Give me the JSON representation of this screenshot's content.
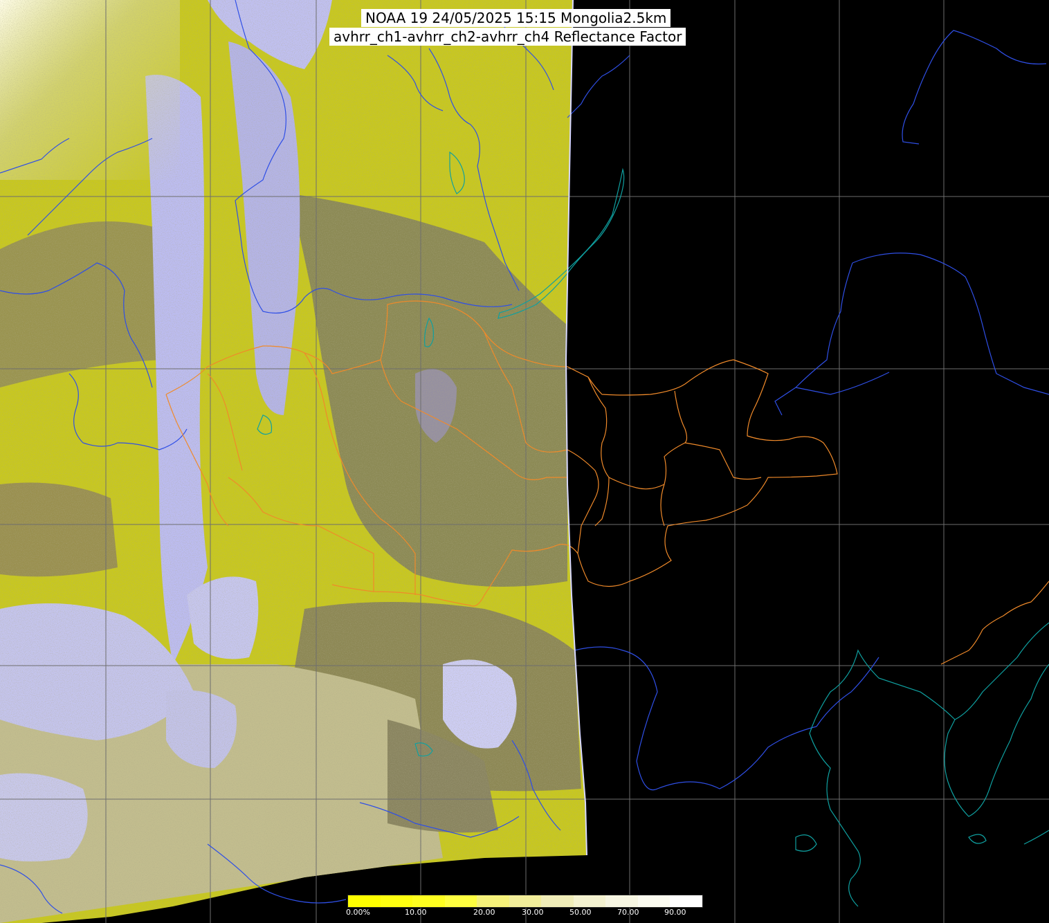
{
  "title": {
    "line1": "NOAA 19 24/05/2025 15:15 Mongolia2.5km",
    "line2": "avhrr_ch1-avhrr_ch2-avhrr_ch4 Reflectance Factor"
  },
  "legend": {
    "labels": [
      "0.00%",
      "10.00",
      "20.00",
      "30.00",
      "50.00",
      "70.00",
      "90.00"
    ],
    "colors": [
      "#ffff00",
      "#ffff10",
      "#ffff20",
      "#ffff40",
      "#f6f27a",
      "#f2ee9a",
      "#f0edb8",
      "#f4f2d0",
      "#f7f6e2",
      "#fbfbf0",
      "#ffffff"
    ]
  },
  "colors": {
    "background": "#000000",
    "scene_yellow": "#c8c81e",
    "scene_olive": "#8c8a55",
    "scene_cloud": "#bcbcf0",
    "scene_khaki": "#c0bc8c",
    "graticule": "#6e6e6e",
    "coastline_blue": "#2f4fe6",
    "coastline_teal": "#0fa0a0",
    "border_orange": "#f08a2a"
  }
}
